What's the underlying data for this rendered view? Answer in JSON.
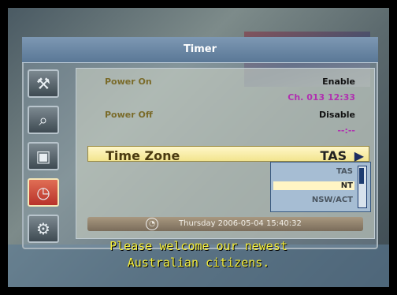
{
  "title": "Timer",
  "sidebar": {
    "items": [
      {
        "icon": "wrench-icon"
      },
      {
        "icon": "magnifier-icon"
      },
      {
        "icon": "lock-icon"
      },
      {
        "icon": "clock-icon"
      },
      {
        "icon": "tools-icon"
      }
    ]
  },
  "power_on": {
    "label": "Power On",
    "value": "Enable",
    "sub": "Ch. 013  12:33"
  },
  "power_off": {
    "label": "Power Off",
    "value": "Disable",
    "sub": "--:--"
  },
  "time_zone": {
    "label": "Time Zone",
    "value": "TAS",
    "arrow": "▶"
  },
  "dropdown": {
    "options": [
      "TAS",
      "NT",
      "NSW/ACT"
    ],
    "selected": "NT"
  },
  "footer": {
    "datetime": "Thursday 2006-05-04 15:40:32"
  },
  "subtitle": {
    "line1": "Please welcome our newest",
    "line2": "Australian citizens."
  }
}
